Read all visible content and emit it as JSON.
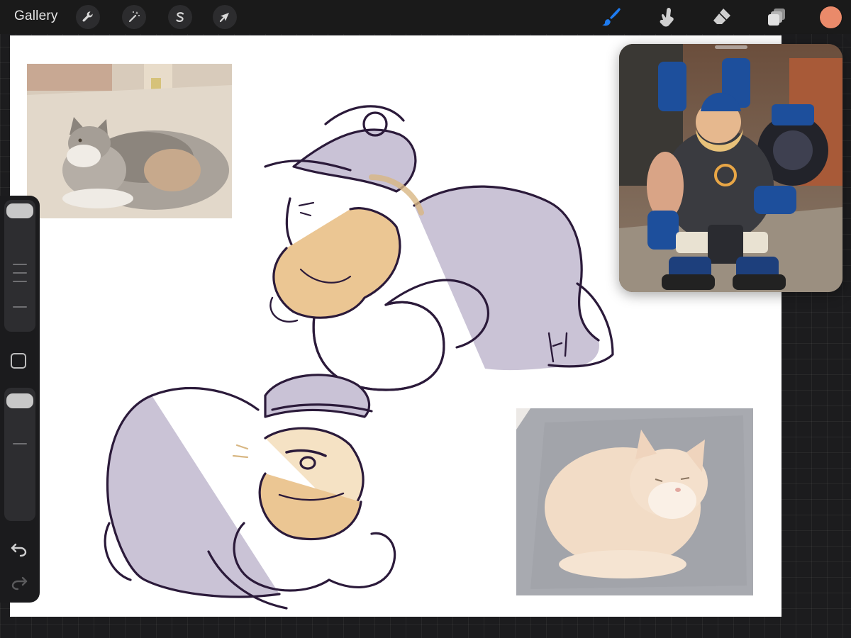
{
  "toolbar": {
    "gallery_label": "Gallery",
    "left_tools": [
      {
        "name": "actions",
        "icon": "wrench-icon"
      },
      {
        "name": "adjustments",
        "icon": "magic-wand-icon"
      },
      {
        "name": "selection",
        "icon": "selection-s-icon"
      },
      {
        "name": "transform",
        "icon": "arrow-cursor-icon"
      }
    ],
    "right_tools": [
      {
        "name": "brush",
        "icon": "brush-icon",
        "active": true
      },
      {
        "name": "smudge",
        "icon": "smudge-finger-icon"
      },
      {
        "name": "eraser",
        "icon": "eraser-icon"
      },
      {
        "name": "layers",
        "icon": "layers-icon"
      }
    ],
    "current_color": "#ea8a6a",
    "active_tool_color": "#1e7bf0"
  },
  "sidebar": {
    "brush_size_level": 0.95,
    "brush_opacity_level": 0.92,
    "modify_icon": "square-modify-icon",
    "undo_icon": "undo-arrow-icon",
    "redo_icon": "redo-arrow-icon"
  },
  "canvas": {
    "background": "#ffffff",
    "sketch_stroke": "#2b1a3a",
    "beard_color": "#e8c48f",
    "shirt_fill": "#c9c2d6"
  },
  "reference": {
    "accent_blue": "#1d4f9c"
  }
}
